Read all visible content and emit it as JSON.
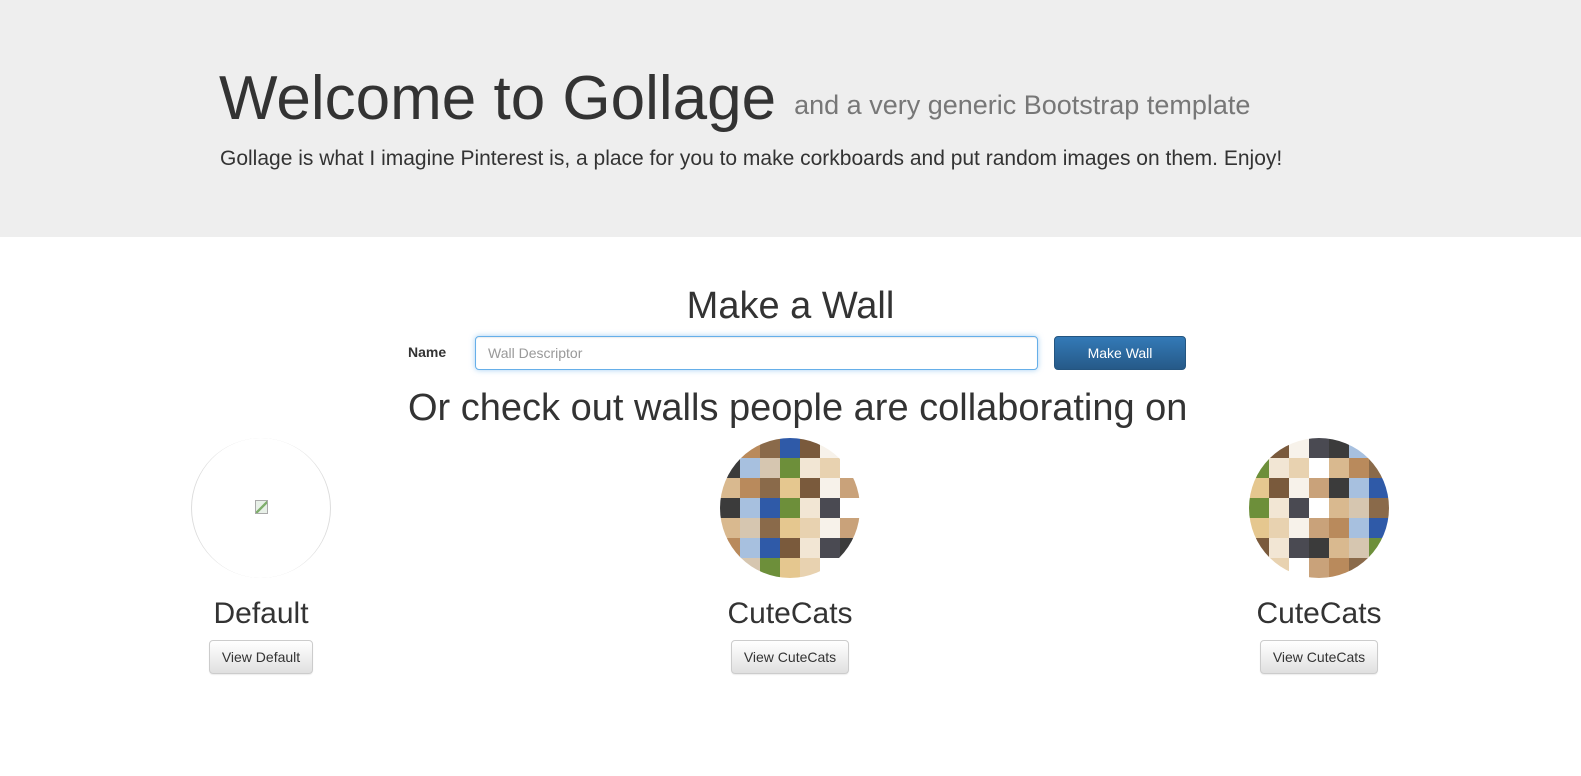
{
  "jumbotron": {
    "title": "Welcome to Gollage",
    "subtitle": "and a very generic Bootstrap template",
    "lead": "Gollage is what I imagine Pinterest is, a place for you to make corkboards and put random images on them. Enjoy!"
  },
  "make_wall": {
    "title": "Make a Wall",
    "name_label": "Name",
    "input_value": "",
    "input_placeholder": "Wall Descriptor",
    "submit_label": "Make Wall"
  },
  "collaborating": {
    "title": "Or check out walls people are collaborating on",
    "walls": [
      {
        "name": "Default",
        "button_label": "View Default",
        "thumbnail": "broken-image-icon"
      },
      {
        "name": "CuteCats",
        "button_label": "View CuteCats",
        "thumbnail": "cat-collage"
      },
      {
        "name": "CuteCats",
        "button_label": "View CuteCats",
        "thumbnail": "cat-collage"
      }
    ]
  },
  "colors": {
    "jumbotron_bg": "#eeeeee",
    "primary": "#337ab7",
    "text": "#333333",
    "muted": "#777777"
  }
}
